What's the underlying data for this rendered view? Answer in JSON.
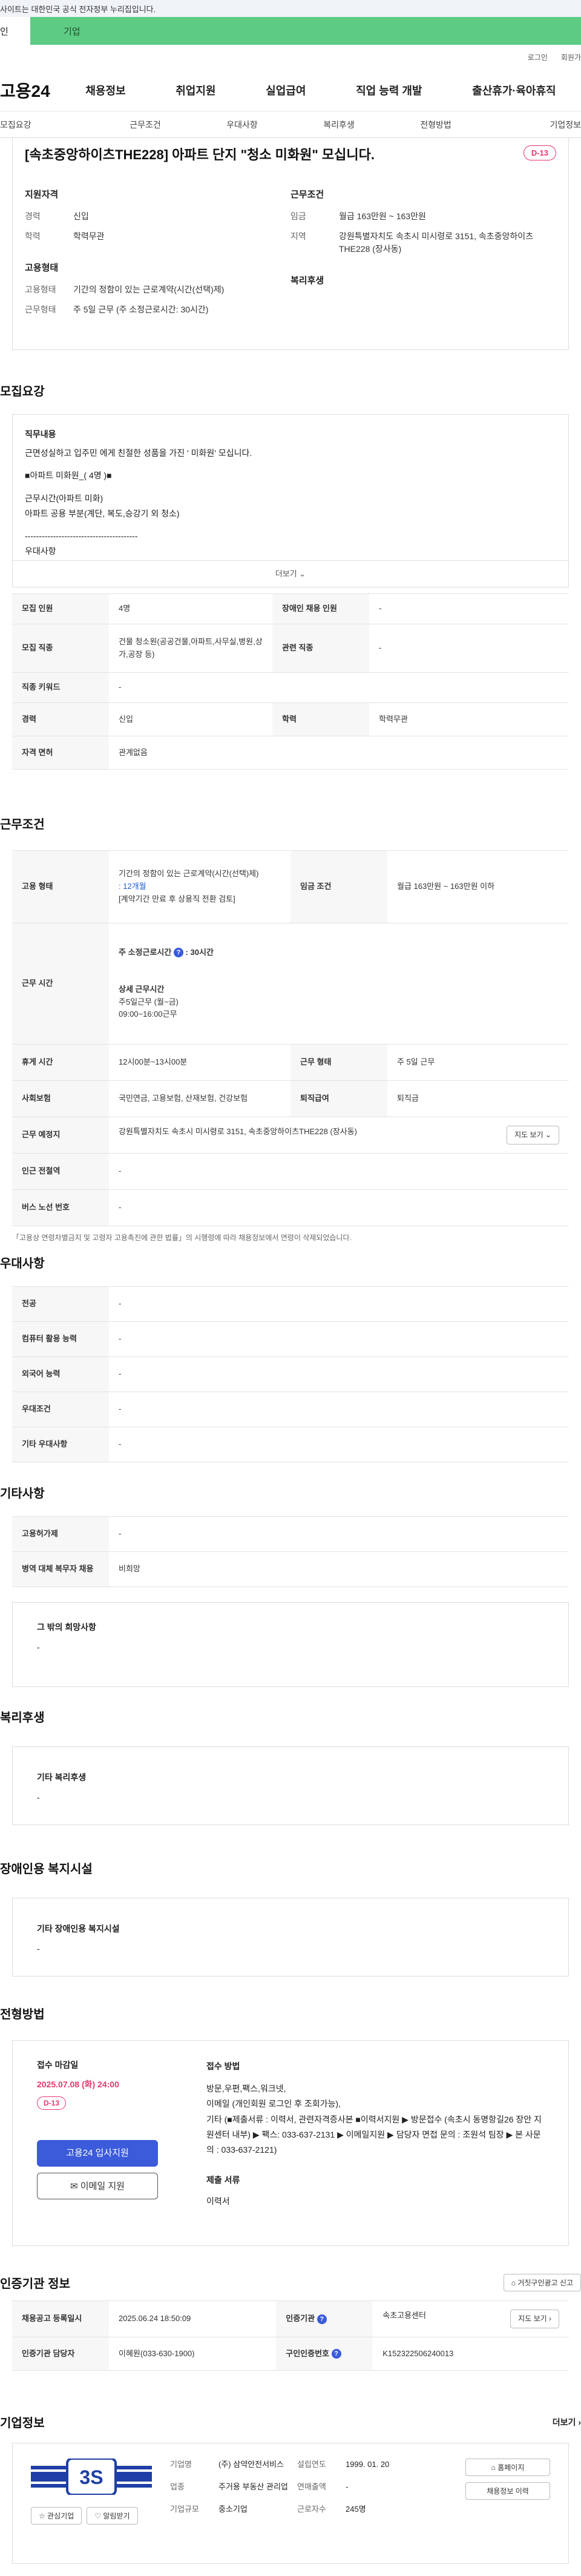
{
  "top": {
    "gov_notice": "사이트는 대한민국 공식 전자정부 누리집입니다.",
    "tab_person": "인",
    "tab_company": "기업",
    "login": "로그인",
    "signup": "회원가"
  },
  "gnb": {
    "logo": "고용24",
    "menu": [
      "채용정보",
      "취업지원",
      "실업급여",
      "직업 능력 개발",
      "출산휴가·육아휴직"
    ]
  },
  "subnav": [
    "모집요강",
    "근무조건",
    "우대사항",
    "복리후생",
    "전형방법",
    "기업정보"
  ],
  "job": {
    "title": "[속초중앙하이츠THE228] 아파트 단지 \"청소 미화원\" 모십니다.",
    "dday": "D-13",
    "qual_head": "지원자격",
    "qual_rows": [
      {
        "k": "경력",
        "v": "신입"
      },
      {
        "k": "학력",
        "v": "학력무관"
      }
    ],
    "emp_head": "고용형태",
    "emp_rows": [
      {
        "k": "고용형태",
        "v": "기간의 정함이 있는 근로계약(시간(선택)제)"
      },
      {
        "k": "근무형태",
        "v": "주 5일 근무 (주 소정근로시간: 30시간)"
      }
    ],
    "cond_head": "근무조건",
    "cond_rows": [
      {
        "k": "임금",
        "v": "월급 163만원 ~ 163만원"
      },
      {
        "k": "지역",
        "v": "강원특별자치도 속초시 미시령로 3151, 속초중앙하이츠THE228 (장사동)"
      }
    ],
    "welfare_head": "복리후생"
  },
  "recruit": {
    "title": "모집요강",
    "desc_label": "직무내용",
    "desc_lines": [
      "근면성실하고 입주민 에게 친절한 성품을 가진 ' 미화원' 모십니다.",
      "",
      "■아파트 미화원_( 4명 )■",
      "",
      "근무시간(아파트 미화)",
      "아파트 공용 부분(계단, 복도,승강기 외 청소)",
      "",
      "----------------------------------------",
      "우대사항"
    ],
    "more": "더보기 ⌄",
    "rows": [
      {
        "k1": "모집 인원",
        "v1": "4명",
        "k2": "장애인 채용 인원",
        "v2": "-"
      },
      {
        "k1": "모집 직종",
        "v1": "건물 청소원(공공건물,아파트,사무실,병원,상가,공장 등)",
        "k2": "관련 직종",
        "v2": "-"
      },
      {
        "k1": "직종 키워드",
        "v1": "-"
      },
      {
        "k1": "경력",
        "v1": "신입",
        "k2": "학력",
        "v2": "학력무관"
      },
      {
        "k1": "자격 면허",
        "v1": "관계없음"
      }
    ]
  },
  "work": {
    "title": "근무조건",
    "emp_type_k": "고용 형태",
    "emp_type_v": "기간의 정함이 있는 근로계약(시간(선택)제)",
    "emp_type_months": ": 12개월",
    "emp_type_note": "[계약기간 만료 후 상용직 전환 검토]",
    "wage_k": "임금 조건",
    "wage_v": "월급 163만원 ~ 163만원 이하",
    "hours_k": "근무 시간",
    "hours_week_label": "주 소정근로시간",
    "hours_week_v": ": 30시간",
    "hours_detail_label": "상세 근무시간",
    "hours_detail_1": "주5일근무 (월~금)",
    "hours_detail_2": "09:00~16:00근무",
    "rest_k": "휴게 시간",
    "rest_v": "12시00분~13시00분",
    "form_k": "근무 형태",
    "form_v": "주 5일 근무",
    "ins_k": "사회보험",
    "ins_v": "국민연금, 고용보험, 산재보험, 건강보험",
    "retire_k": "퇴직급여",
    "retire_v": "퇴직금",
    "place_k": "근무 예정지",
    "place_v": "강원특별자치도 속초시 미시령로 3151, 속초중앙하이츠THE228 (장사동)",
    "map_btn": "지도 보기 ⌄",
    "subway_k": "인근 전철역",
    "subway_v": "-",
    "bus_k": "버스 노선 번호",
    "bus_v": "-",
    "note": "「고용상 연령차별금지 및 고령자 고용촉진에 관한 법률」의 시행령에 따라 채용정보에서 연령이 삭제되었습니다."
  },
  "pref": {
    "title": "우대사항",
    "rows": [
      {
        "k": "전공",
        "v": "-"
      },
      {
        "k": "컴퓨터 활용 능력",
        "v": "-"
      },
      {
        "k": "외국어 능력",
        "v": "-"
      },
      {
        "k": "우대조건",
        "v": "-"
      },
      {
        "k": "기타 우대사항",
        "v": "-"
      }
    ]
  },
  "etc": {
    "title": "기타사항",
    "rows": [
      {
        "k": "고용허가제",
        "v": "-"
      },
      {
        "k": "병역 대체 복무자 채용",
        "v": "비희망"
      }
    ],
    "hope_label": "그 밖의 희망사항",
    "hope_v": "-"
  },
  "welfare": {
    "title": "복리후생",
    "label": "기타 복리후생",
    "v": "-"
  },
  "disabled": {
    "title": "장애인용 복지시설",
    "label": "기타 장애인용 복지시설",
    "v": "-"
  },
  "selection": {
    "title": "전형방법",
    "deadline_label": "접수 마감일",
    "deadline_v": "2025.07.08 (화) 24:00",
    "dday": "D-13",
    "apply_btn": "고용24 입사지원",
    "email_btn": "이메일 지원",
    "method_label": "접수 방법",
    "method_lines": [
      "방문,우편,팩스,워크넷,",
      "이메일 (개인회원 로그인 후 조회가능),",
      "기타 (■제출서류 : 이력서, 관련자격증사본 ■이력서지원 ▶ 방문접수 (속초시 동명항길26 장안 지원센터 내부) ▶ 팩스: 033-637-2131 ▶ 이메일지원 ▶ 담당자 면접 문의 : 조원석 팀장 ▶ 본 사문의 : 033-637-2121)"
    ],
    "docs_label": "제출 서류",
    "docs_v": "이력서"
  },
  "agency": {
    "title": "인증기관 정보",
    "report_btn": "거짓구인광고 신고",
    "reg_k": "채용공고 등록일시",
    "reg_v": "2025.06.24 18:50:09",
    "org_k": "인증기관",
    "org_v": "속초고용센터",
    "map_btn": "지도 보기 ›",
    "mgr_k": "인증기관 담당자",
    "mgr_v": "이혜원(033-630-1900)",
    "num_k": "구인인증번호",
    "num_v": "K152322506240013"
  },
  "company": {
    "title": "기업정보",
    "more": "더보기 ›",
    "logo_text": "3S",
    "fav_btn": "관심기업",
    "follow_btn": "알림받기",
    "name_k": "기업명",
    "name_v": "(주) 삼약안전서비스",
    "ind_k": "업종",
    "ind_v": "주거용 부동산 관리업",
    "scale_k": "기업규모",
    "scale_v": "중소기업",
    "found_k": "설립연도",
    "found_v": "1999. 01. 20",
    "sales_k": "연매출액",
    "sales_v": "-",
    "emp_k": "근로자수",
    "emp_v": "245명",
    "home_btn": "홈페이지",
    "history_btn": "채용정보 이력"
  },
  "colors": {
    "accent": "#3b5bdb",
    "dday": "#e9366e",
    "company_tab": "#5ecb84"
  }
}
